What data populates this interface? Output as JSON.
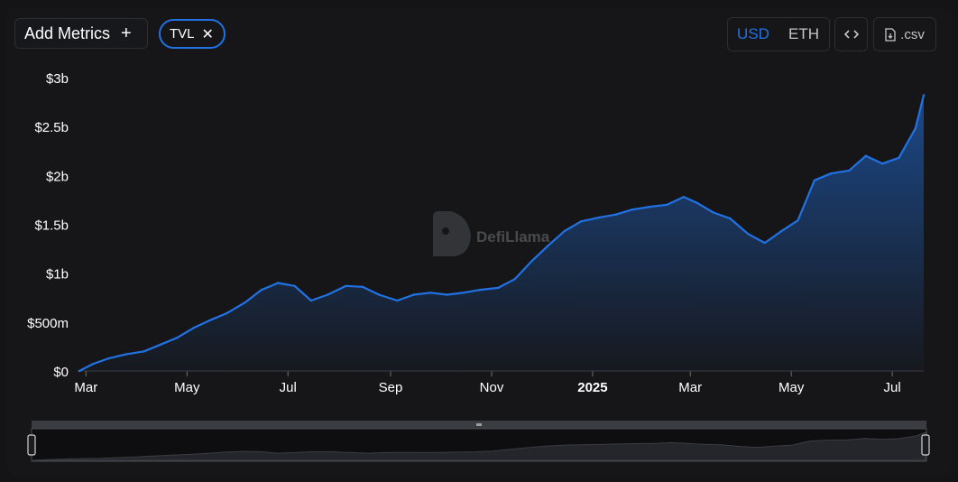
{
  "controls": {
    "add_metrics_label": "Add Metrics",
    "add_icon": "plus-icon",
    "metric_chip_label": "TVL",
    "remove_icon": "close-icon",
    "denominations": [
      "USD",
      "ETH"
    ],
    "active_denomination": "USD",
    "embed_icon": "code-icon",
    "csv_label": ".csv",
    "csv_icon": "file-download-icon"
  },
  "watermark": "DefiLlama",
  "colors": {
    "line": "#2172e5",
    "accent": "#2172e5",
    "background": "#161618",
    "axis_text": "#ffffff"
  },
  "chart_data": {
    "type": "area",
    "series": [
      {
        "name": "TVL",
        "x": [
          "2024-02-26",
          "2024-03-05",
          "2024-03-15",
          "2024-03-25",
          "2024-04-05",
          "2024-04-15",
          "2024-04-25",
          "2024-05-05",
          "2024-05-15",
          "2024-05-25",
          "2024-06-05",
          "2024-06-15",
          "2024-06-25",
          "2024-07-05",
          "2024-07-15",
          "2024-07-25",
          "2024-08-05",
          "2024-08-15",
          "2024-08-25",
          "2024-09-05",
          "2024-09-15",
          "2024-09-25",
          "2024-10-05",
          "2024-10-15",
          "2024-10-25",
          "2024-11-05",
          "2024-11-15",
          "2024-11-25",
          "2024-12-05",
          "2024-12-15",
          "2024-12-25",
          "2025-01-05",
          "2025-01-15",
          "2025-01-25",
          "2025-02-05",
          "2025-02-15",
          "2025-02-25",
          "2025-03-05",
          "2025-03-15",
          "2025-03-25",
          "2025-04-05",
          "2025-04-15",
          "2025-04-25",
          "2025-05-05",
          "2025-05-15",
          "2025-05-25",
          "2025-06-05",
          "2025-06-15",
          "2025-06-25",
          "2025-07-05",
          "2025-07-15",
          "2025-07-20"
        ],
        "values": [
          0,
          70,
          130,
          170,
          200,
          270,
          340,
          440,
          520,
          590,
          700,
          830,
          900,
          870,
          720,
          780,
          870,
          860,
          780,
          720,
          780,
          800,
          780,
          800,
          830,
          850,
          940,
          1120,
          1280,
          1430,
          1530,
          1570,
          1600,
          1650,
          1680,
          1700,
          1780,
          1720,
          1620,
          1560,
          1400,
          1310,
          1430,
          1540,
          1950,
          2020,
          2050,
          2200,
          2120,
          2180,
          2480,
          2820
        ]
      }
    ],
    "x_ticks": [
      {
        "date": "2024-03-01",
        "label": "Mar",
        "bold": false
      },
      {
        "date": "2024-05-01",
        "label": "May",
        "bold": false
      },
      {
        "date": "2024-07-01",
        "label": "Jul",
        "bold": false
      },
      {
        "date": "2024-09-01",
        "label": "Sep",
        "bold": false
      },
      {
        "date": "2024-11-01",
        "label": "Nov",
        "bold": false
      },
      {
        "date": "2025-01-01",
        "label": "2025",
        "bold": true
      },
      {
        "date": "2025-03-01",
        "label": "Mar",
        "bold": false
      },
      {
        "date": "2025-05-01",
        "label": "May",
        "bold": false
      },
      {
        "date": "2025-07-01",
        "label": "Jul",
        "bold": false
      }
    ],
    "y_ticks": [
      {
        "value": 0,
        "label": "$0"
      },
      {
        "value": 500,
        "label": "$500m"
      },
      {
        "value": 1000,
        "label": "$1b"
      },
      {
        "value": 1500,
        "label": "$1.5b"
      },
      {
        "value": 2000,
        "label": "$2b"
      },
      {
        "value": 2500,
        "label": "$2.5b"
      },
      {
        "value": 3000,
        "label": "$3b"
      }
    ],
    "xlim": [
      "2024-02-26",
      "2025-07-20"
    ],
    "ylim": [
      0,
      3000
    ],
    "y_unit": "USD millions",
    "grid": false,
    "legend": "none"
  }
}
